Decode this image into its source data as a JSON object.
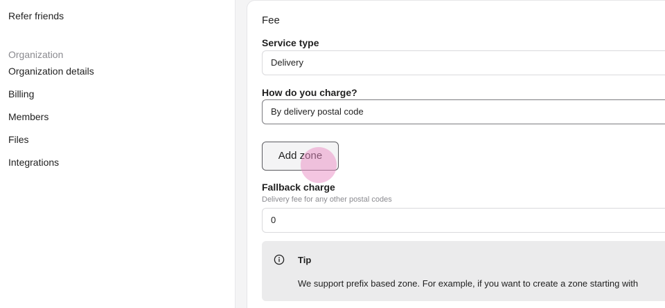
{
  "sidebar": {
    "refer_friends": "Refer friends",
    "organization_heading": "Organization",
    "items": [
      {
        "label": "Organization details"
      },
      {
        "label": "Billing"
      },
      {
        "label": "Members"
      },
      {
        "label": "Files"
      },
      {
        "label": "Integrations"
      }
    ]
  },
  "fee_card": {
    "title": "Fee",
    "service_type": {
      "label": "Service type",
      "value": "Delivery"
    },
    "charge_method": {
      "label": "How do you charge?",
      "value": "By delivery postal code"
    },
    "add_zone_label": "Add zone",
    "fallback": {
      "label": "Fallback charge",
      "help": "Delivery fee for any other postal codes",
      "value": "0"
    },
    "tip": {
      "icon": "info-icon",
      "title": "Tip",
      "text": "We support prefix based zone. For example, if you want to create a zone starting with"
    }
  },
  "colors": {
    "sidebar_bg": "#ffffff",
    "main_bg": "#f4f4f5",
    "muted_text": "#8a8a8f",
    "tip_bg": "#ebebec",
    "click_indicator": "#e98cc4"
  }
}
